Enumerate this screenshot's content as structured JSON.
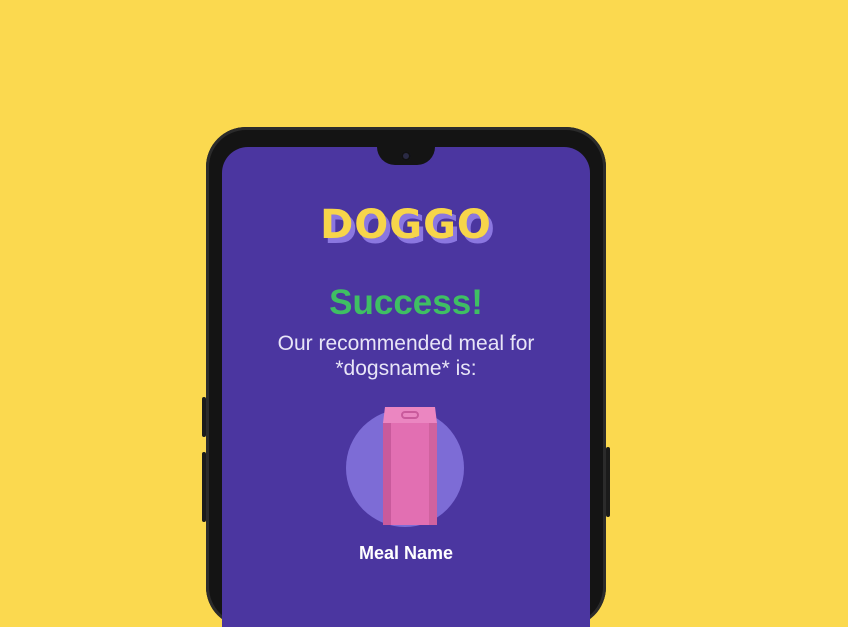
{
  "app": {
    "logo_text": "DOGGO",
    "title": "Success!",
    "subtitle_line1": "Our recommended meal for",
    "subtitle_line2": "*dogsname* is:",
    "meal_name": "Meal Name"
  },
  "colors": {
    "background": "#fbd94f",
    "screen": "#4b36a0",
    "logo": "#f7d54a",
    "success": "#3fbf63",
    "bag": "#e26fb2"
  },
  "icons": {
    "bag": "food-bag-icon",
    "camera": "front-camera-icon"
  }
}
